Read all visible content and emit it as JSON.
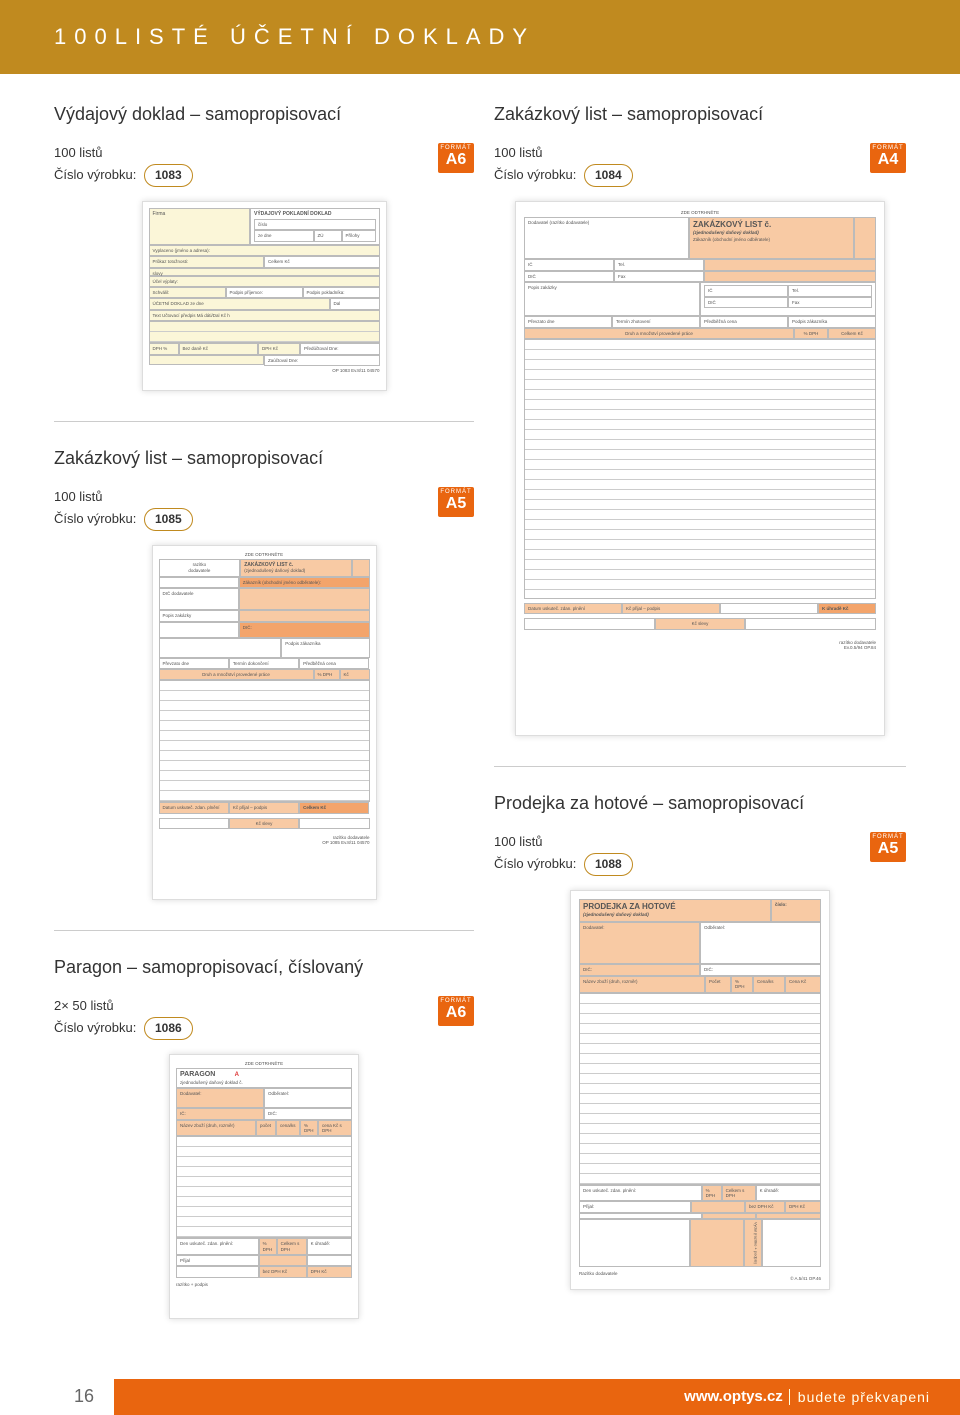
{
  "header": {
    "title": "100LISTÉ ÚČETNÍ DOKLADY"
  },
  "items": {
    "p1083": {
      "title": "Výdajový doklad – samopropisovací",
      "sheets": "100 listů",
      "sku_label": "Číslo výrobku:",
      "sku": "1083",
      "fmt_label": "FORMÁT",
      "fmt": "A6"
    },
    "p1085": {
      "title": "Zakázkový list – samopropisovací",
      "sheets": "100 listů",
      "sku_label": "Číslo výrobku:",
      "sku": "1085",
      "fmt_label": "FORMÁT",
      "fmt": "A5"
    },
    "p1086": {
      "title": "Paragon – samopropisovací, číslovaný",
      "sheets": "2× 50 listů",
      "sku_label": "Číslo výrobku:",
      "sku": "1086",
      "fmt_label": "FORMÁT",
      "fmt": "A6"
    },
    "p1084": {
      "title": "Zakázkový list – samopropisovací",
      "sheets": "100 listů",
      "sku_label": "Číslo výrobku:",
      "sku": "1084",
      "fmt_label": "FORMÁT",
      "fmt": "A4"
    },
    "p1088": {
      "title": "Prodejka za hotové – samopropisovací",
      "sheets": "100 listů",
      "sku_label": "Číslo výrobku:",
      "sku": "1088",
      "fmt_label": "FORMÁT",
      "fmt": "A5"
    }
  },
  "forms": {
    "vydajovy": {
      "title": "VÝDAJOVÝ POKLADNÍ DOKLAD",
      "firma": "Firma",
      "cislo": "číslo",
      "ze_dne": "ze dne",
      "zu": "ZÚ",
      "prijmy": "Přílohy",
      "vyplaceno": "Vyplaceno (jméno a adresa):",
      "prukaz": "Průkaz totožnosti:",
      "celkem": "Celkem Kč",
      "ucel": "Účel výplaty:",
      "schvalil": "Schválil:",
      "podpis_prij": "Podpis příjemce:",
      "podpis_pok": "Podpis pokladníka:",
      "ud": "ÚČETNÍ DOKLAD ze dne",
      "dal": "Dal",
      "text_line": "Text     Učtovací předpis Má dáti/Dal     Kč     h",
      "dph": "DPH %",
      "bez": "Bez daně Kč",
      "dphkc": "DPH Kč",
      "preduc": "Předúčtoval\nDne:",
      "zauct": "Zaúčtoval\nDne:",
      "footnote": "OP 1083   Ev.8/11   04570"
    },
    "zakazkovy_small": {
      "title": "ZAKÁZKOVÝ LIST č.",
      "sub": "(zjednodušený daňový doklad)",
      "zakaznik": "Zákazník (obchodní jméno odběratele):",
      "dic_dod": "DIČ dodavatele",
      "popis": "Popis zakázky",
      "dic": "DIČ:",
      "podpis": "Podpis zákazníka",
      "prevzato": "Převzato dne",
      "termin": "Termín dokončení",
      "predbezna": "Předběžná cena",
      "druh": "Druh a množství provedené práce",
      "sdph": "% DPH",
      "kc": "Kč",
      "datum": "Datum uskuteč. zdan. plnění",
      "prijal": "Kč přijal – podpis",
      "celkem_kc": "Celkem Kč",
      "slevy": "Kč slevy",
      "razitko": "razítko dodavatele",
      "footnote": "OP 1085   Ev.8/11   04570"
    },
    "paragon": {
      "title": "PARAGON",
      "a": "A",
      "sub": "zjednodušený daňový doklad č.",
      "dodavatel": "Dodavatel:",
      "odberatel": "Odběratel:",
      "ic": "IČ:",
      "dic": "DIČ:",
      "nazev": "Název zboží (druh, rozměr)",
      "pocet": "počet",
      "cena_ks": "cena/ks",
      "dphp": "% DPH",
      "cena_sdph": "cena Kč s DPH",
      "den": "Den uskuteč. zdan. plnění:",
      "prijal": "Přijal",
      "sdph": "% DPH",
      "celkem_sdph": "Celkem s DPH",
      "kuh": "K úhradě:",
      "bez_dph": "bez DPH Kč",
      "dph_kc": "DPH Kč",
      "razitko": "razítko + podpis"
    },
    "zakazkovy_big": {
      "title": "ZAKÁZKOVÝ LIST č.",
      "sub": "(zjednodušený daňový doklad)",
      "dod": "Dodavatel (razítko dodavatele)",
      "zak": "Zákazník (obchodní jméno odběratele)",
      "ic": "IČ",
      "tel": "Tel.",
      "dic": "DIČ",
      "fax": "Fax",
      "popis": "Popis zakázky",
      "prevzato": "Převzato dne",
      "termin": "Termín zhotovení",
      "predbezna": "Předběžná cena",
      "podpis": "Podpis zákazníka",
      "druh": "Druh a množství provedené práce",
      "sdph": "% DPH",
      "celkem": "Celkem Kč",
      "datum": "Datum uskuteč. zdan. plnění",
      "prijal": "Kč přijal – podpis",
      "kuh": "K úhradě Kč",
      "slevy": "Kč slevy",
      "razitko": "razítko dodavatele",
      "footnote": "Ev.0.5/94  OP.84"
    },
    "prodejka": {
      "title": "PRODEJKA ZA HOTOVÉ",
      "sub": "(zjednodušený daňový doklad)",
      "cislo": "číslo:",
      "dod": "Dodavatel:",
      "odb": "Odběratel:",
      "dic": "DIČ:",
      "nazev": "Název zboží (druh, rozměr)",
      "pocet": "Počet",
      "sdph": "% DPH",
      "cenaks": "Cena/ks",
      "cenakc": "Cena Kč",
      "den": "Den uskuteč. zdan. plnění:",
      "prijal": "Přijal:",
      "sdph2": "% DPH",
      "celkem_sdph": "Celkem s DPH",
      "kuh": "K úhradě:",
      "bez": "bez DPH Kč",
      "dphkc": "DPH Kč",
      "vydal": "Vydal (razítko + podpis)",
      "razitko": "Razítko dodavatele",
      "footnote": "© A.5/41 OP.46"
    }
  },
  "footer": {
    "page": "16",
    "url": "www.optys.cz",
    "tag": "budete překvapeni"
  }
}
